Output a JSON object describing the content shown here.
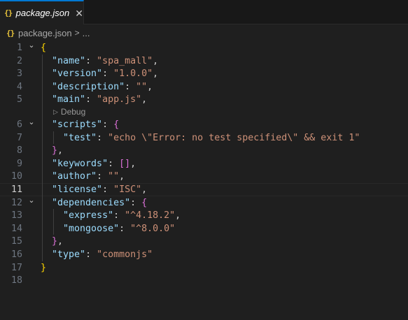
{
  "tab": {
    "icon": "{}",
    "title": "package.json",
    "close_glyph": "✕"
  },
  "breadcrumb": {
    "icon": "{}",
    "file": "package.json",
    "separator": ">",
    "more": "..."
  },
  "codelens": {
    "label": "Debug"
  },
  "editor": {
    "current_line": 11,
    "lines": [
      {
        "n": "1",
        "fold": true,
        "tokens": [
          [
            "b1",
            "{"
          ]
        ]
      },
      {
        "n": "2",
        "fold": false,
        "tokens": [
          [
            "p",
            "  "
          ],
          [
            "k",
            "\"name\""
          ],
          [
            "p",
            ": "
          ],
          [
            "s",
            "\"spa_mall\""
          ],
          [
            "p",
            ","
          ]
        ]
      },
      {
        "n": "3",
        "fold": false,
        "tokens": [
          [
            "p",
            "  "
          ],
          [
            "k",
            "\"version\""
          ],
          [
            "p",
            ": "
          ],
          [
            "s",
            "\"1.0.0\""
          ],
          [
            "p",
            ","
          ]
        ]
      },
      {
        "n": "4",
        "fold": false,
        "tokens": [
          [
            "p",
            "  "
          ],
          [
            "k",
            "\"description\""
          ],
          [
            "p",
            ": "
          ],
          [
            "s",
            "\"\""
          ],
          [
            "p",
            ","
          ]
        ]
      },
      {
        "n": "5",
        "fold": false,
        "tokens": [
          [
            "p",
            "  "
          ],
          [
            "k",
            "\"main\""
          ],
          [
            "p",
            ": "
          ],
          [
            "s",
            "\"app.js\""
          ],
          [
            "p",
            ","
          ]
        ]
      },
      {
        "n": "6",
        "fold": true,
        "tokens": [
          [
            "p",
            "  "
          ],
          [
            "k",
            "\"scripts\""
          ],
          [
            "p",
            ": "
          ],
          [
            "b2",
            "{"
          ]
        ]
      },
      {
        "n": "7",
        "fold": false,
        "tokens": [
          [
            "p",
            "    "
          ],
          [
            "k",
            "\"test\""
          ],
          [
            "p",
            ": "
          ],
          [
            "s",
            "\"echo \\\"Error: no test specified\\\" && exit 1\""
          ]
        ]
      },
      {
        "n": "8",
        "fold": false,
        "tokens": [
          [
            "p",
            "  "
          ],
          [
            "b2",
            "}"
          ],
          [
            "p",
            ","
          ]
        ]
      },
      {
        "n": "9",
        "fold": false,
        "tokens": [
          [
            "p",
            "  "
          ],
          [
            "k",
            "\"keywords\""
          ],
          [
            "p",
            ": "
          ],
          [
            "b2",
            "[]"
          ],
          [
            "p",
            ","
          ]
        ]
      },
      {
        "n": "10",
        "fold": false,
        "tokens": [
          [
            "p",
            "  "
          ],
          [
            "k",
            "\"author\""
          ],
          [
            "p",
            ": "
          ],
          [
            "s",
            "\"\""
          ],
          [
            "p",
            ","
          ]
        ]
      },
      {
        "n": "11",
        "fold": false,
        "tokens": [
          [
            "p",
            "  "
          ],
          [
            "k",
            "\"license\""
          ],
          [
            "p",
            ": "
          ],
          [
            "s",
            "\"ISC\""
          ],
          [
            "p",
            ","
          ]
        ]
      },
      {
        "n": "12",
        "fold": true,
        "tokens": [
          [
            "p",
            "  "
          ],
          [
            "k",
            "\"dependencies\""
          ],
          [
            "p",
            ": "
          ],
          [
            "b2",
            "{"
          ]
        ]
      },
      {
        "n": "13",
        "fold": false,
        "tokens": [
          [
            "p",
            "    "
          ],
          [
            "k",
            "\"express\""
          ],
          [
            "p",
            ": "
          ],
          [
            "s",
            "\"^4.18.2\""
          ],
          [
            "p",
            ","
          ]
        ]
      },
      {
        "n": "14",
        "fold": false,
        "tokens": [
          [
            "p",
            "    "
          ],
          [
            "k",
            "\"mongoose\""
          ],
          [
            "p",
            ": "
          ],
          [
            "s",
            "\"^8.0.0\""
          ]
        ]
      },
      {
        "n": "15",
        "fold": false,
        "tokens": [
          [
            "p",
            "  "
          ],
          [
            "b2",
            "}"
          ],
          [
            "p",
            ","
          ]
        ]
      },
      {
        "n": "16",
        "fold": false,
        "tokens": [
          [
            "p",
            "  "
          ],
          [
            "k",
            "\"type\""
          ],
          [
            "p",
            ": "
          ],
          [
            "s",
            "\"commonjs\""
          ]
        ]
      },
      {
        "n": "17",
        "fold": false,
        "tokens": [
          [
            "b1",
            "}"
          ]
        ]
      },
      {
        "n": "18",
        "fold": false,
        "tokens": []
      }
    ]
  }
}
